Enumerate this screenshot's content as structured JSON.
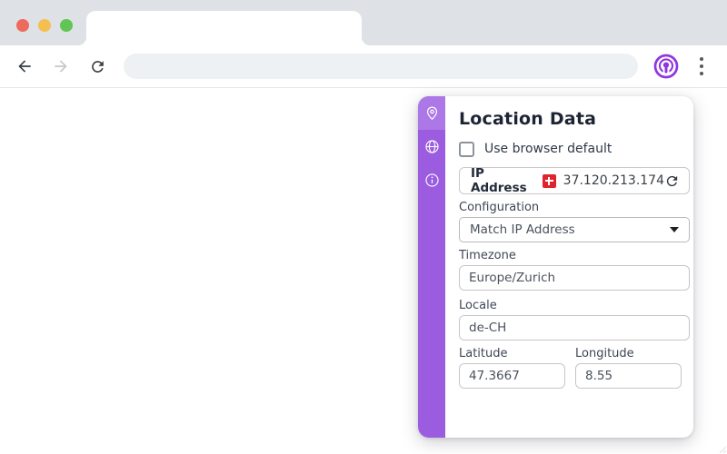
{
  "window": {
    "controls": [
      "close",
      "minimize",
      "zoom"
    ]
  },
  "browser": {
    "address_bar_value": "",
    "nav": {
      "back": "back",
      "forward": "forward",
      "reload": "reload"
    },
    "extension_icon": "vytal-location-extension",
    "menu_icon": "kebab-menu"
  },
  "popup": {
    "title": "Location Data",
    "checkbox": {
      "label": "Use browser default",
      "checked": false
    },
    "ip_row": {
      "label": "IP Address",
      "value": "37.120.213.174",
      "country": "CH",
      "flag": "swiss-flag",
      "action": "refresh"
    },
    "configuration": {
      "label": "Configuration",
      "value": "Match IP Address"
    },
    "timezone": {
      "label": "Timezone",
      "value": "Europe/Zurich"
    },
    "locale": {
      "label": "Locale",
      "value": "de-CH"
    },
    "latitude": {
      "label": "Latitude",
      "value": "47.3667"
    },
    "longitude": {
      "label": "Longitude",
      "value": "8.55"
    },
    "sidebar": {
      "items": [
        "location-pin",
        "globe",
        "info"
      ],
      "active": "location-pin"
    }
  },
  "colors": {
    "sidebar_purple": "#9b5ce0",
    "sidebar_active_purple": "#ac77e7",
    "extension_purple": "#9036df",
    "flag_red": "#e0242c",
    "tabstrip_gray": "#dee1e6",
    "title_text": "#1d2433"
  }
}
